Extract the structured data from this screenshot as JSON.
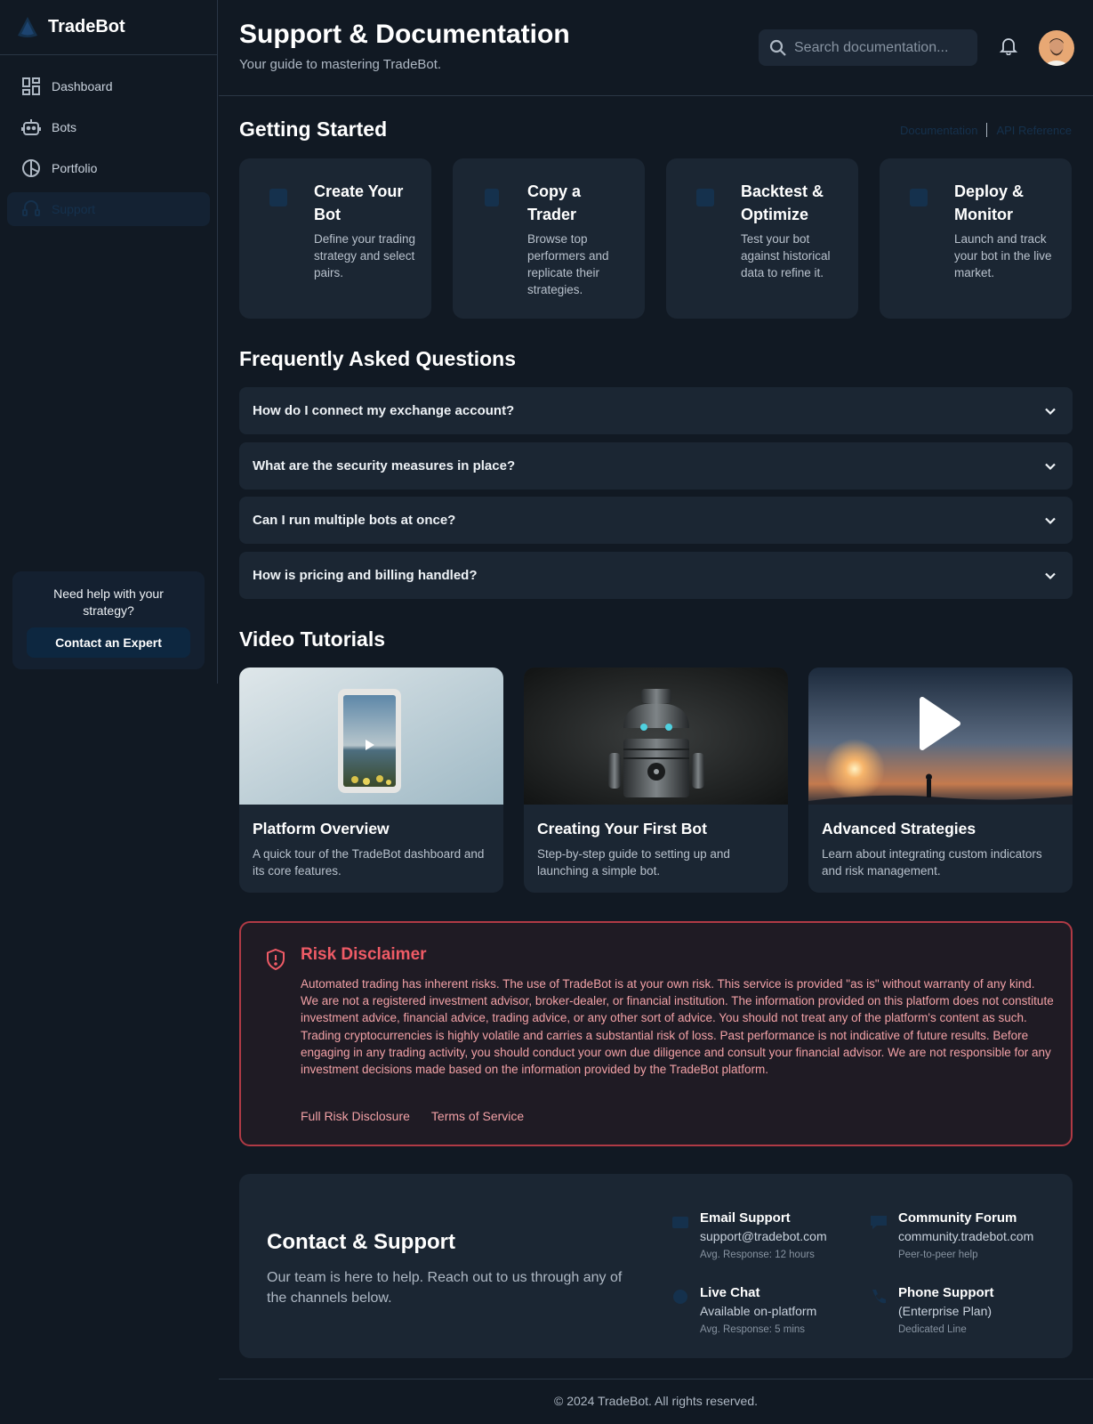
{
  "brand": {
    "name": "TradeBot"
  },
  "sidebar": {
    "items": [
      {
        "label": "Dashboard",
        "icon": "dashboard-icon",
        "active": false
      },
      {
        "label": "Bots",
        "icon": "robot-icon",
        "active": false
      },
      {
        "label": "Portfolio",
        "icon": "pie-chart-icon",
        "active": false
      },
      {
        "label": "Support",
        "icon": "support-icon",
        "active": true
      }
    ],
    "help": {
      "text": "Need help with your strategy?",
      "button": "Contact an Expert"
    }
  },
  "header": {
    "title": "Support & Documentation",
    "subtitle": "Your guide to mastering TradeBot.",
    "search_placeholder": "Search documentation..."
  },
  "getting_started": {
    "title": "Getting Started",
    "links": [
      "Documentation",
      "API Reference"
    ],
    "cards": [
      {
        "title": "Create Your Bot",
        "desc": "Define your trading strategy and select pairs."
      },
      {
        "title": "Copy a Trader",
        "desc": "Browse top performers and replicate their strategies."
      },
      {
        "title": "Backtest & Optimize",
        "desc": "Test your bot against historical data to refine it."
      },
      {
        "title": "Deploy & Monitor",
        "desc": "Launch and track your bot in the live market."
      }
    ]
  },
  "faq": {
    "title": "Frequently Asked Questions",
    "items": [
      "How do I connect my exchange account?",
      "What are the security measures in place?",
      "Can I run multiple bots at once?",
      "How is pricing and billing handled?"
    ]
  },
  "videos": {
    "title": "Video Tutorials",
    "items": [
      {
        "title": "Platform Overview",
        "desc": "A quick tour of the TradeBot dashboard and its core features."
      },
      {
        "title": "Creating Your First Bot",
        "desc": "Step-by-step guide to setting up and launching a simple bot."
      },
      {
        "title": "Advanced Strategies",
        "desc": "Learn about integrating custom indicators and risk management."
      }
    ]
  },
  "risk": {
    "title": "Risk Disclaimer",
    "text": "Automated trading has inherent risks. The use of TradeBot is at your own risk. This service is provided \"as is\" without warranty of any kind. We are not a registered investment advisor, broker-dealer, or financial institution. The information provided on this platform does not constitute investment advice, financial advice, trading advice, or any other sort of advice. You should not treat any of the platform's content as such. Trading cryptocurrencies is highly volatile and carries a substantial risk of loss. Past performance is not indicative of future results. Before engaging in any trading activity, you should conduct your own due diligence and consult your financial advisor. We are not responsible for any investment decisions made based on the information provided by the TradeBot platform.",
    "links": [
      "Full Risk Disclosure",
      "Terms of Service"
    ]
  },
  "contact": {
    "title": "Contact & Support",
    "desc": "Our team is here to help. Reach out to us through any of the channels below.",
    "channels": [
      {
        "title": "Email Support",
        "line": "support@tradebot.com",
        "note": "Avg. Response: 12 hours",
        "icon": "email-icon"
      },
      {
        "title": "Community Forum",
        "line": "community.tradebot.com",
        "note": "Peer-to-peer help",
        "icon": "forum-icon"
      },
      {
        "title": "Live Chat",
        "line": "Available on-platform",
        "note": "Avg. Response: 5 mins",
        "icon": "chat-icon"
      },
      {
        "title": "Phone Support",
        "line": "(Enterprise Plan)",
        "note": "Dedicated Line",
        "icon": "phone-icon"
      }
    ]
  },
  "footer": {
    "text": "© 2024 TradeBot. All rights reserved."
  },
  "colors": {
    "background": "#111923",
    "card": "#1b2633",
    "accent_dark": "#15314d",
    "danger": "#ef5b66"
  }
}
